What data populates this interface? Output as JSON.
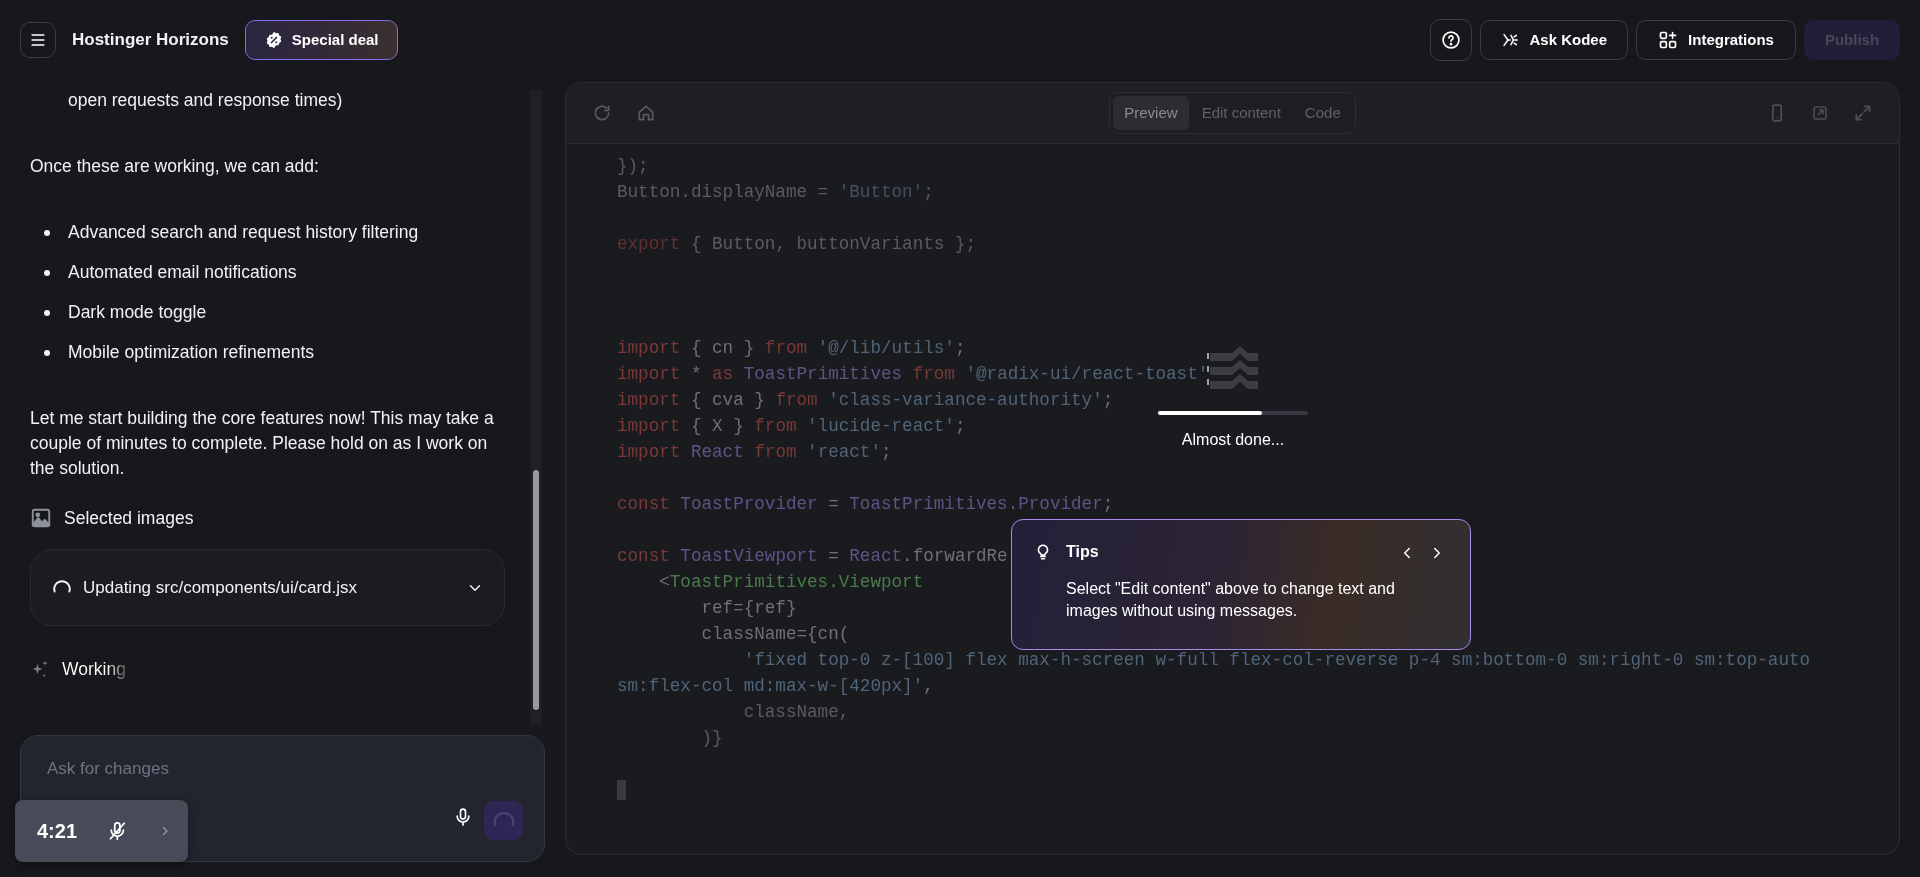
{
  "header": {
    "brand": "Hostinger Horizons",
    "deal": "Special deal",
    "actions": [
      {
        "kind": "help"
      },
      {
        "kind": "kodee",
        "label": "Ask Kodee"
      },
      {
        "kind": "integrations",
        "label": "Integrations"
      },
      {
        "kind": "publish",
        "label": "Publish",
        "disabled": true
      }
    ]
  },
  "chat": {
    "messages": [
      {
        "kind": "continuation",
        "text": "open requests and response times)"
      },
      {
        "kind": "paragraph",
        "text": "Once these are working, we can add:"
      },
      {
        "kind": "bullets",
        "items": [
          "Advanced search and request history filtering",
          "Automated email notifications",
          "Dark mode toggle",
          "Mobile optimization refinements"
        ]
      },
      {
        "kind": "paragraph",
        "text": "Let me start building the core features now! This may take a couple of minutes to complete. Please hold on as I work on the solution."
      }
    ],
    "attachment": "Selected images",
    "task": {
      "label": "Updating src/components/ui/card.jsx",
      "expanded": false
    },
    "status": "Working"
  },
  "input": {
    "placeholder": "Ask for changes"
  },
  "recorder": {
    "time": "4:21",
    "muted": true
  },
  "preview": {
    "tabs": [
      {
        "label": "Preview",
        "selected": true
      },
      {
        "label": "Edit content",
        "selected": false
      },
      {
        "label": "Code",
        "selected": false
      }
    ],
    "code": [
      {
        "kind": "code",
        "faded": true,
        "tokens": [
          {
            "kind": "plain",
            "text": "});"
          }
        ]
      },
      {
        "kind": "code",
        "faded": true,
        "tokens": [
          {
            "kind": "plain",
            "text": "Button.displayName = "
          },
          {
            "kind": "str",
            "text": "'Button'"
          },
          {
            "kind": "plain",
            "text": ";"
          }
        ]
      },
      {
        "kind": "blank"
      },
      {
        "kind": "code",
        "faded": true,
        "tokens": [
          {
            "kind": "kw",
            "text": "export"
          },
          {
            "kind": "plain",
            "text": " { Button, buttonVariants };"
          }
        ]
      },
      {
        "kind": "blank"
      },
      {
        "kind": "blank"
      },
      {
        "kind": "blank"
      },
      {
        "kind": "code",
        "faded": false,
        "tokens": [
          {
            "kind": "kw",
            "text": "import"
          },
          {
            "kind": "plain",
            "text": " { cn } "
          },
          {
            "kind": "kw",
            "text": "from"
          },
          {
            "kind": "str",
            "text": " '@/lib/utils'"
          },
          {
            "kind": "plain",
            "text": ";"
          }
        ]
      },
      {
        "kind": "code",
        "faded": false,
        "tokens": [
          {
            "kind": "kw",
            "text": "import"
          },
          {
            "kind": "plain",
            "text": " * "
          },
          {
            "kind": "kw",
            "text": "as"
          },
          {
            "kind": "id",
            "text": " ToastPrimitives"
          },
          {
            "kind": "kw",
            "text": " from"
          },
          {
            "kind": "str",
            "text": " '@radix-ui/react-toast'"
          }
        ]
      },
      {
        "kind": "code",
        "faded": false,
        "tokens": [
          {
            "kind": "kw",
            "text": "import"
          },
          {
            "kind": "plain",
            "text": " { cva } "
          },
          {
            "kind": "kw",
            "text": "from"
          },
          {
            "kind": "str",
            "text": " 'class-variance-authority'"
          },
          {
            "kind": "plain",
            "text": ";"
          }
        ]
      },
      {
        "kind": "code",
        "faded": false,
        "tokens": [
          {
            "kind": "kw",
            "text": "import"
          },
          {
            "kind": "plain",
            "text": " { X } "
          },
          {
            "kind": "kw",
            "text": "from"
          },
          {
            "kind": "str",
            "text": " 'lucide-react'"
          },
          {
            "kind": "plain",
            "text": ";"
          }
        ]
      },
      {
        "kind": "code",
        "faded": false,
        "tokens": [
          {
            "kind": "kw",
            "text": "import"
          },
          {
            "kind": "id",
            "text": " React"
          },
          {
            "kind": "kw",
            "text": " from"
          },
          {
            "kind": "str",
            "text": " 'react'"
          },
          {
            "kind": "plain",
            "text": ";"
          }
        ]
      },
      {
        "kind": "blank"
      },
      {
        "kind": "code",
        "faded": false,
        "tokens": [
          {
            "kind": "kw",
            "text": "const"
          },
          {
            "kind": "id",
            "text": " ToastProvider"
          },
          {
            "kind": "plain",
            "text": " = "
          },
          {
            "kind": "id",
            "text": "ToastPrimitives.Provider"
          },
          {
            "kind": "plain",
            "text": ";"
          }
        ]
      },
      {
        "kind": "blank"
      },
      {
        "kind": "code",
        "faded": false,
        "tokens": [
          {
            "kind": "kw",
            "text": "const"
          },
          {
            "kind": "id",
            "text": " ToastViewport"
          },
          {
            "kind": "plain",
            "text": " = "
          },
          {
            "kind": "id",
            "text": "React"
          },
          {
            "kind": "plain",
            "text": ".forwardRe"
          }
        ]
      },
      {
        "kind": "code",
        "faded": false,
        "tokens": [
          {
            "kind": "plain",
            "text": "    <"
          },
          {
            "kind": "tag",
            "text": "ToastPrimitives.Viewport"
          }
        ]
      },
      {
        "kind": "code",
        "faded": false,
        "tokens": [
          {
            "kind": "plain",
            "text": "        ref={ref}"
          }
        ]
      },
      {
        "kind": "code",
        "faded": false,
        "tokens": [
          {
            "kind": "plain",
            "text": "        className={cn("
          }
        ]
      },
      {
        "kind": "code",
        "faded": false,
        "tokens": [
          {
            "kind": "str",
            "text": "            'fixed top-0 z-[100] flex max-h-screen w-full flex-col-reverse p-4 sm:bottom-0 sm:right-0 sm:top-auto"
          }
        ]
      },
      {
        "kind": "code",
        "faded": false,
        "tokens": [
          {
            "kind": "str",
            "text": "sm:flex-col md:max-w-[420px]'"
          },
          {
            "kind": "plain",
            "text": ","
          }
        ]
      },
      {
        "kind": "code",
        "faded": true,
        "tokens": [
          {
            "kind": "plain",
            "text": "            className,"
          }
        ]
      },
      {
        "kind": "code",
        "faded": true,
        "tokens": [
          {
            "kind": "plain",
            "text": "        )}"
          }
        ]
      },
      {
        "kind": "blank"
      },
      {
        "kind": "cursor"
      }
    ],
    "loader": {
      "level": 0.69,
      "label": "Almost done..."
    },
    "tips": {
      "title": "Tips",
      "text": "Select \"Edit content\" above to change text and images without using messages."
    }
  }
}
